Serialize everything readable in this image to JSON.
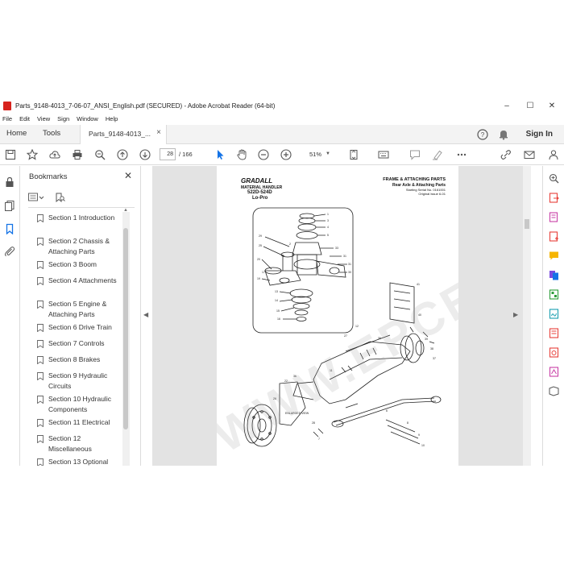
{
  "window": {
    "title": "Parts_9148-4013_7-06-07_ANSI_English.pdf (SECURED) - Adobe Acrobat Reader (64-bit)",
    "controls": {
      "minimize": "–",
      "maximize": "☐",
      "close": "✕"
    }
  },
  "menu": [
    "File",
    "Edit",
    "View",
    "Sign",
    "Window",
    "Help"
  ],
  "tabs": {
    "home": "Home",
    "tools": "Tools",
    "document": "Parts_9148-4013_...",
    "close": "×",
    "sign_in": "Sign In"
  },
  "toolbar": {
    "current_page": "28",
    "total_pages": "/ 166",
    "zoom": "51%",
    "icons": [
      "save-icon",
      "star-icon",
      "upload-icon",
      "print-icon",
      "search-icon",
      "page-up-icon",
      "page-down-icon",
      "select-arrow-icon",
      "hand-icon",
      "zoom-out-icon",
      "zoom-in-icon",
      "fit-page-icon",
      "keyboard-icon",
      "comment-icon",
      "highlight-icon",
      "more-icon",
      "share-icon",
      "mail-icon",
      "profile-icon"
    ]
  },
  "bookmarks": {
    "title": "Bookmarks",
    "close": "✕",
    "items": [
      "Section 1 Introduction",
      "Section 2 Chassis & Attaching Parts",
      "Section 3 Boom",
      "Section 4 Attachments",
      "Section 5 Engine & Attaching Parts",
      "Section 6 Drive Train",
      "Section 7 Controls",
      "Section 8 Brakes",
      "Section 9 Hydraulic Circuits",
      "Section 10 Hydraulic Components",
      "Section 11 Electrical",
      "Section 12 Miscellaneous",
      "Section 13 Optional"
    ]
  },
  "page": {
    "brand": "GRADALL",
    "model_line1": "MATERIAL HANDLER",
    "model_line2": "522D-524D",
    "model_line3": "Lo-Pro",
    "header_title": "FRAME & ATTACHING PARTS",
    "header_sub": "Rear Axle & Attaching Parts",
    "serial": "Starting Serial No. 0161001",
    "issue": "Original Issue 6-01",
    "inset_label": "ENLARGED VIEW",
    "watermark": "WWW.EPCEPO.COM"
  },
  "colors": {
    "accent": "#1473e6",
    "pdf_red": "#d7231d",
    "viewer_bg": "#e3e3e3"
  }
}
